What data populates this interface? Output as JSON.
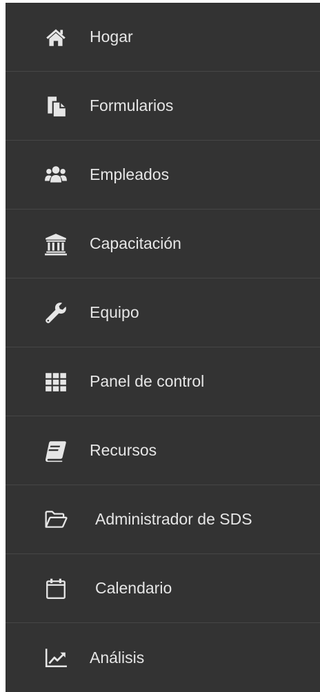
{
  "sidebar": {
    "items": [
      {
        "label": "Hogar",
        "icon": "home-icon"
      },
      {
        "label": "Formularios",
        "icon": "copy-icon"
      },
      {
        "label": "Empleados",
        "icon": "users-icon"
      },
      {
        "label": "Capacitación",
        "icon": "bank-icon"
      },
      {
        "label": "Equipo",
        "icon": "wrench-icon"
      },
      {
        "label": "Panel de control",
        "icon": "grid-icon"
      },
      {
        "label": "Recursos",
        "icon": "book-icon"
      },
      {
        "label": "Administrador de SDS",
        "icon": "folder-open-icon"
      },
      {
        "label": "Calendario",
        "icon": "calendar-icon"
      },
      {
        "label": "Análisis",
        "icon": "line-chart-icon"
      }
    ],
    "colors": {
      "background": "#333333",
      "divider": "#464646",
      "text": "#e6e6e6",
      "icon": "#e6e6e6"
    }
  }
}
